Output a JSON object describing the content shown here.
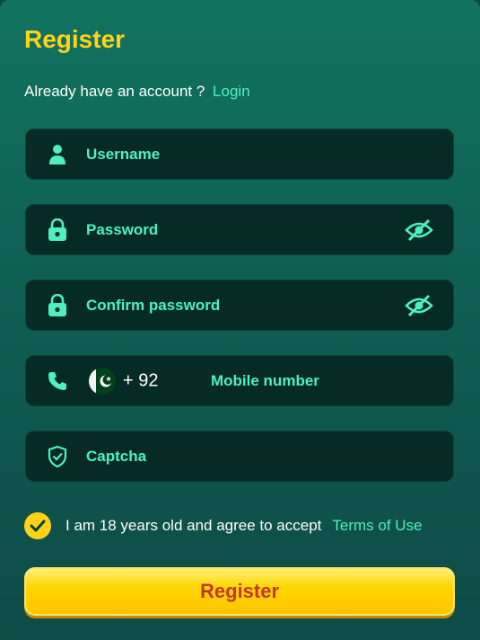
{
  "header": {
    "title": "Register"
  },
  "login_prompt": {
    "text": "Already have an account ?",
    "link": "Login"
  },
  "fields": {
    "username": {
      "placeholder": "Username",
      "icon": "user-icon"
    },
    "password": {
      "placeholder": "Password",
      "icon": "lock-icon",
      "toggle_icon": "eye-off-icon"
    },
    "confirm_password": {
      "placeholder": "Confirm password",
      "icon": "lock-icon",
      "toggle_icon": "eye-off-icon"
    },
    "mobile": {
      "icon": "phone-icon",
      "flag": "pakistan-flag-icon",
      "country_code": "+ 92",
      "placeholder": "Mobile number"
    },
    "captcha": {
      "placeholder": "Captcha",
      "icon": "shield-check-icon"
    }
  },
  "agreement": {
    "checked": true,
    "text": "I am 18 years old and agree to accept",
    "link": "Terms of Use"
  },
  "submit": {
    "label": "Register"
  },
  "colors": {
    "accent": "#4ff0c0",
    "title": "#ffd21a",
    "button": "#ffd600",
    "button_text": "#c0392b"
  }
}
